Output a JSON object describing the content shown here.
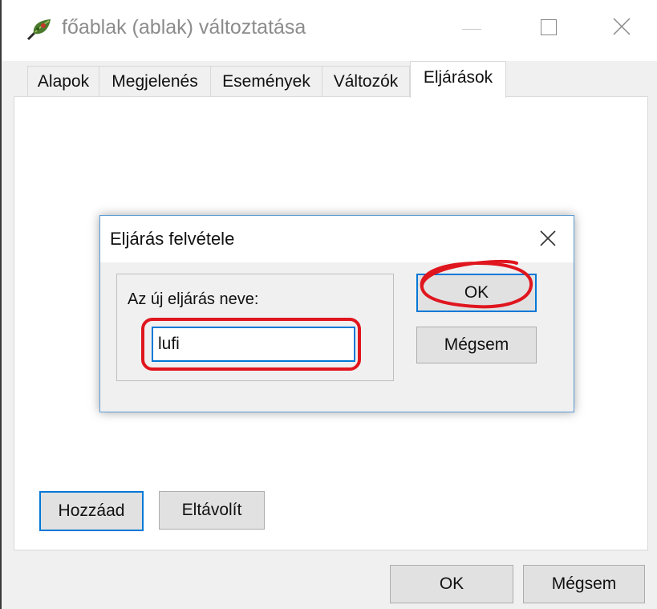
{
  "window": {
    "title": "főablak (ablak) változtatása",
    "tabs": [
      {
        "label": "Alapok"
      },
      {
        "label": "Megjelenés"
      },
      {
        "label": "Események"
      },
      {
        "label": "Változók"
      },
      {
        "label": "Eljárások",
        "active": true
      }
    ],
    "panel_buttons": {
      "add": "Hozzáad",
      "remove": "Eltávolít"
    },
    "footer": {
      "ok": "OK",
      "cancel": "Mégsem"
    }
  },
  "dialog": {
    "title": "Eljárás felvétele",
    "group_label": "Az új eljárás neve:",
    "name_value": "lufi",
    "ok": "OK",
    "cancel": "Mégsem"
  },
  "icons": {
    "app": "leaf-icon",
    "minimize": "minimize-icon",
    "maximize": "maximize-icon",
    "close": "close-icon"
  },
  "annotation_color": "#e0161e",
  "accent_color": "#0078d7"
}
